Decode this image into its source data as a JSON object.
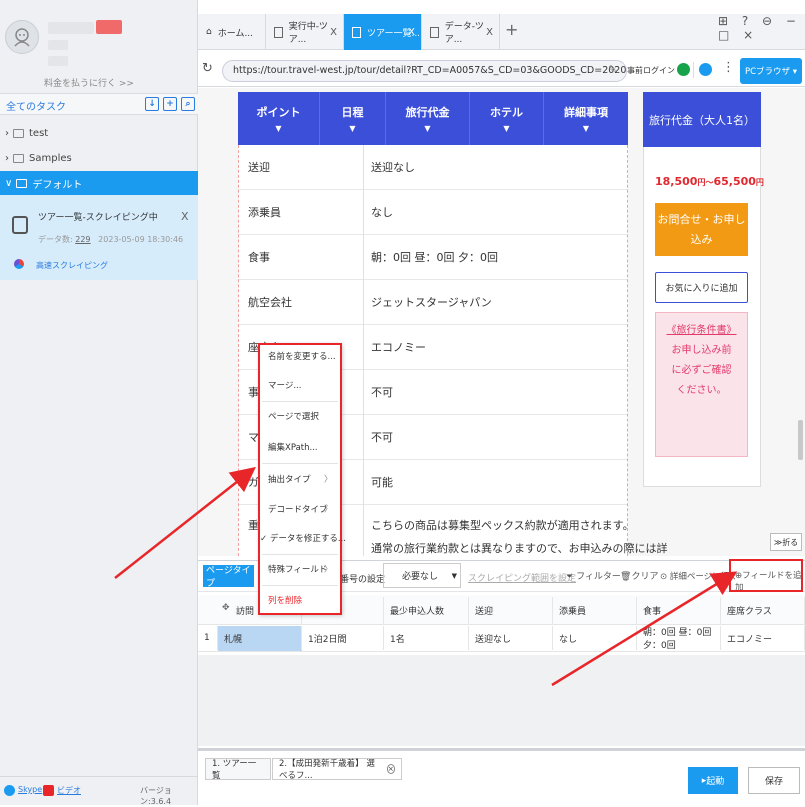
{
  "sidebar": {
    "pay_link": "料金を払うに行く >>",
    "tasks_title": "全てのタスク",
    "folders": [
      "test",
      "Samples",
      "デフォルト"
    ],
    "task": {
      "name": "ツアー一覧-スクレイピング中",
      "close": "X",
      "count_label": "データ数:",
      "count": "229",
      "timestamp": "2023-05-09 18:30:46",
      "fast_label": "高速スクレイピング"
    },
    "skype": "Skype",
    "video": "ビデオ",
    "version": "バージョン:3.6.4"
  },
  "tabs": [
    {
      "label": "ホーム...",
      "icon": "home-icon"
    },
    {
      "label": "実行中-ツア...",
      "icon": "doc-icon",
      "close": "X"
    },
    {
      "label": "ツアー一覧...",
      "icon": "doc-icon",
      "close": "X"
    },
    {
      "label": "データ-ツア...",
      "icon": "doc-icon",
      "close": "X"
    }
  ],
  "new_tab": "+",
  "window_controls": "⊞ ? ⊖ − □ ×",
  "address": {
    "url": "https://tour.travel-west.jp/tour/detail?RT_CD=A0057&S_CD=03&GOODS_CD=20201F-GKN...",
    "login": "事前ログイン",
    "browser_btn": "PCブラウザ ▾"
  },
  "page_nav": [
    "ポイント",
    "日程",
    "旅行代金",
    "ホテル",
    "詳細事項"
  ],
  "detail_rows": [
    {
      "label": "送迎",
      "value": "送迎なし"
    },
    {
      "label": "添乗員",
      "value": "なし"
    },
    {
      "label": "食事",
      "value": "朝：0回 昼：0回 夕：0回"
    },
    {
      "label": "航空会社",
      "value": "ジェットスタージャパン"
    },
    {
      "label": "座席クラス",
      "value": "エコノミー"
    },
    {
      "label": "事",
      "value": "不可"
    },
    {
      "label": "マ",
      "value": "不可"
    },
    {
      "label": "ガ",
      "value": "可能"
    },
    {
      "label": "重",
      "value": "こちらの商品は募集型ペックス約款が適用されます。"
    }
  ],
  "detail_extra": "通常の旅行業約款とは異なりますので、お申込みの際には詳",
  "side_panel": {
    "title": "旅行代金（大人1名）",
    "price": "18,500",
    "price_unit1": "円～",
    "price2": "65,500",
    "price_unit2": "円",
    "inquiry": "お問合せ・お申し込み",
    "favorite": "お気に入りに追加",
    "terms_title": "《旅行条件書》",
    "terms_body": "お申し込み前に必ずご確認ください。"
  },
  "fold": "≫折る",
  "context_menu": [
    "名前を変更する...",
    "マージ...",
    "ページで選択",
    "編集XPath...",
    "抽出タイプ",
    "デコードタイプ",
    "✓ データを修正する...",
    "特殊フィールド",
    "列を削除"
  ],
  "toolbar": {
    "page_type": "ページタイプ",
    "label_setting": "番号の設定",
    "select_value": "必要なし",
    "scope": "スクレイピング範囲を設定",
    "filter": "フィルター",
    "clear": "クリア",
    "goto_detail": "詳細ページに行く",
    "add_field": "フィールドを追加"
  },
  "table": {
    "columns": [
      "訪問",
      "",
      "最少申込人数",
      "送迎",
      "添乗員",
      "食事",
      "座席クラス"
    ],
    "rows": [
      {
        "index": "1",
        "cells": [
          "札幌",
          "1泊2日間",
          "1名",
          "送迎なし",
          "なし",
          "朝：0回 昼：0回 夕：0回",
          "エコノミー"
        ]
      }
    ]
  },
  "bottom_tabs": [
    "1. ツアー一覧",
    "2.【成田発新千歳着】 選べるフ..."
  ],
  "launch": "起動",
  "save": "保存",
  "colors": {
    "accent": "#1a9bf0",
    "nav": "#3b4fd8",
    "highlight": "#e8262a"
  }
}
